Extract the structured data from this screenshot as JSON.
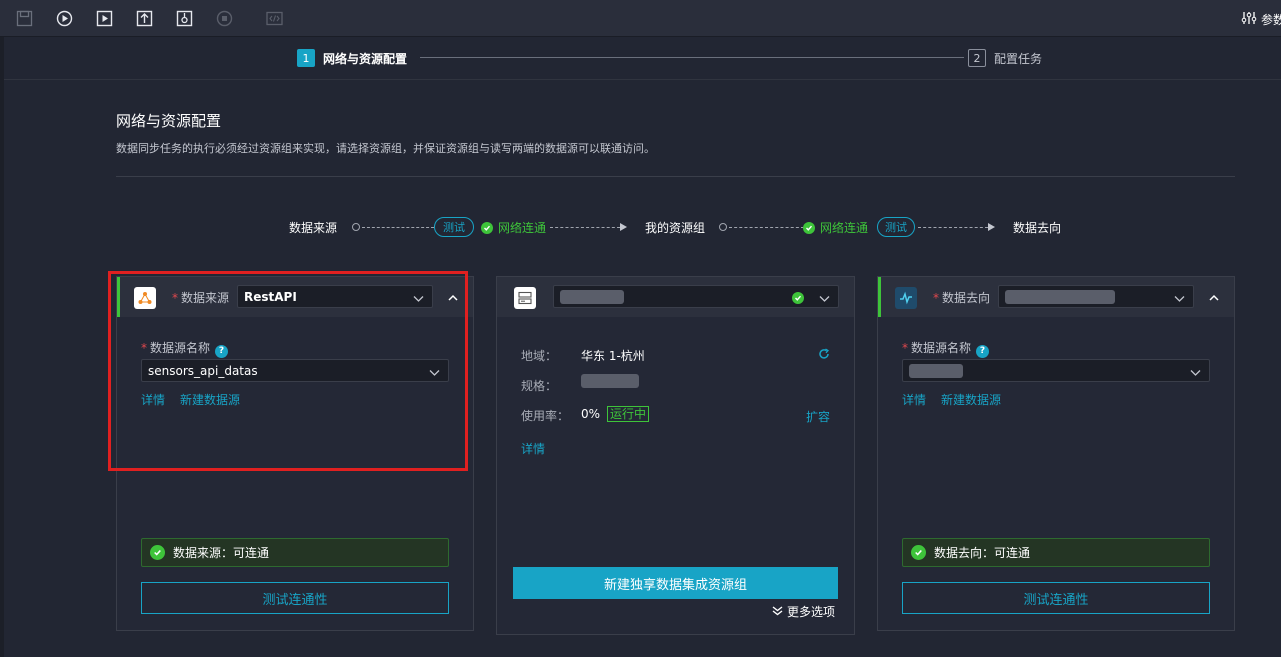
{
  "toolbar": {
    "icons": [
      "save-icon",
      "run-icon",
      "run-advanced-icon",
      "submit-icon",
      "publish-icon",
      "stop-icon",
      "code-icon"
    ],
    "params_label": "参数"
  },
  "stepper": {
    "steps": [
      {
        "num": "1",
        "label": "网络与资源配置",
        "active": true
      },
      {
        "num": "2",
        "label": "配置任务",
        "active": false
      }
    ]
  },
  "section": {
    "title": "网络与资源配置",
    "description": "数据同步任务的执行必须经过资源组来实现，请选择资源组，并保证资源组与读写两端的数据源可以联通访问。"
  },
  "flow": {
    "source": "数据来源",
    "test_left": "测试",
    "network_left": "网络连通",
    "resource": "我的资源组",
    "network_right": "网络连通",
    "test_right": "测试",
    "target": "数据去向"
  },
  "source_card": {
    "type_label": "数据来源",
    "type_value": "RestAPI",
    "name_label": "数据源名称",
    "name_value": "sensors_api_datas",
    "detail_link": "详情",
    "new_link": "新建数据源",
    "status": "数据来源：可连通",
    "test_button": "测试连通性"
  },
  "resource_card": {
    "region_label": "地域：",
    "region_value": "华东 1-杭州",
    "spec_label": "规格：",
    "usage_label": "使用率：",
    "usage_value": "0%",
    "running": "运行中",
    "expand_link": "扩容",
    "detail_link": "详情",
    "new_button": "新建独享数据集成资源组",
    "more_options": "更多选项"
  },
  "target_card": {
    "type_label": "数据去向",
    "name_label": "数据源名称",
    "detail_link": "详情",
    "new_link": "新建数据源",
    "status": "数据去向：可连通",
    "test_button": "测试连通性"
  },
  "colors": {
    "accent": "#18a4c6",
    "success": "#3ec43a",
    "highlight": "#e02020",
    "background": "#222633"
  }
}
